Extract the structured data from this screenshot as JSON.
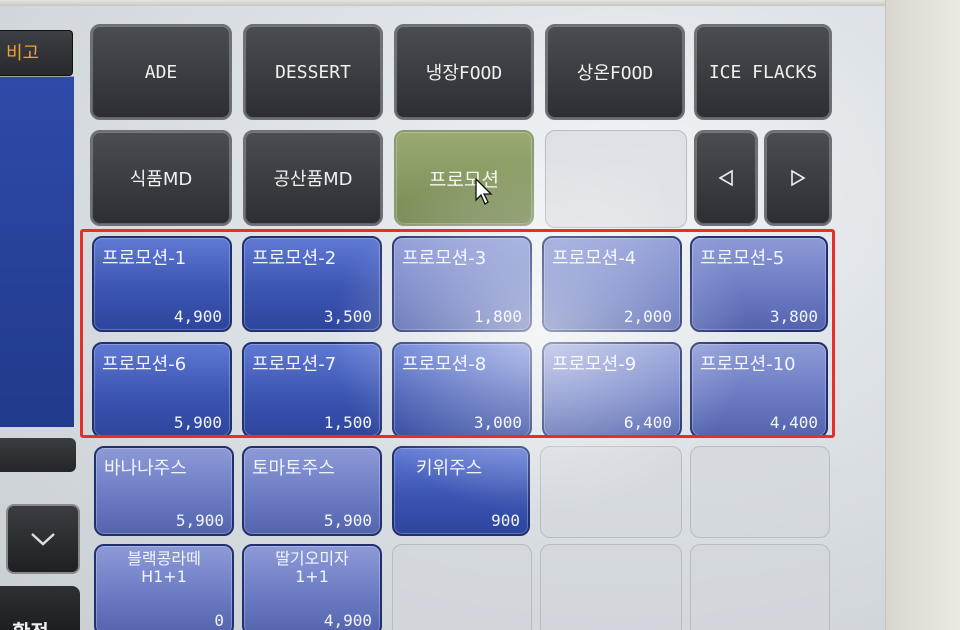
{
  "left_panel": {
    "header_label": "비고",
    "confirm_label": "확정"
  },
  "category_row1": [
    {
      "label": "ADE"
    },
    {
      "label": "DESSERT"
    },
    {
      "label": "냉장FOOD"
    },
    {
      "label": "상온FOOD"
    },
    {
      "label": "ICE FLACKS"
    }
  ],
  "category_row2": [
    {
      "label": "식품MD"
    },
    {
      "label": "공산품MD"
    },
    {
      "label": "프로모션",
      "selected": true
    }
  ],
  "nav": {
    "prev_icon": "triangle-left-icon",
    "next_icon": "triangle-right-icon",
    "scroll_down_icon": "chevron-down-icon"
  },
  "products": [
    {
      "name": "프로모션-1",
      "price": "4,900"
    },
    {
      "name": "프로모션-2",
      "price": "3,500"
    },
    {
      "name": "프로모션-3",
      "price": "1,800"
    },
    {
      "name": "프로모션-4",
      "price": "2,000"
    },
    {
      "name": "프로모션-5",
      "price": "3,800"
    },
    {
      "name": "프로모션-6",
      "price": "5,900"
    },
    {
      "name": "프로모션-7",
      "price": "1,500"
    },
    {
      "name": "프로모션-8",
      "price": "3,000"
    },
    {
      "name": "프로모션-9",
      "price": "6,400"
    },
    {
      "name": "프로모션-10",
      "price": "4,400"
    },
    {
      "name": "바나나주스",
      "price": "5,900"
    },
    {
      "name": "토마토주스",
      "price": "5,900"
    },
    {
      "name": "키위주스",
      "price": "900"
    },
    {
      "name": "블랙콩라떼\nH1+1",
      "price": "0"
    },
    {
      "name": "딸기오미자\n1+1",
      "price": "4,900"
    }
  ],
  "colors": {
    "highlight_border": "#e5302a",
    "product_blue": "#3c55b2",
    "selected_green": "#8a9a6a"
  }
}
